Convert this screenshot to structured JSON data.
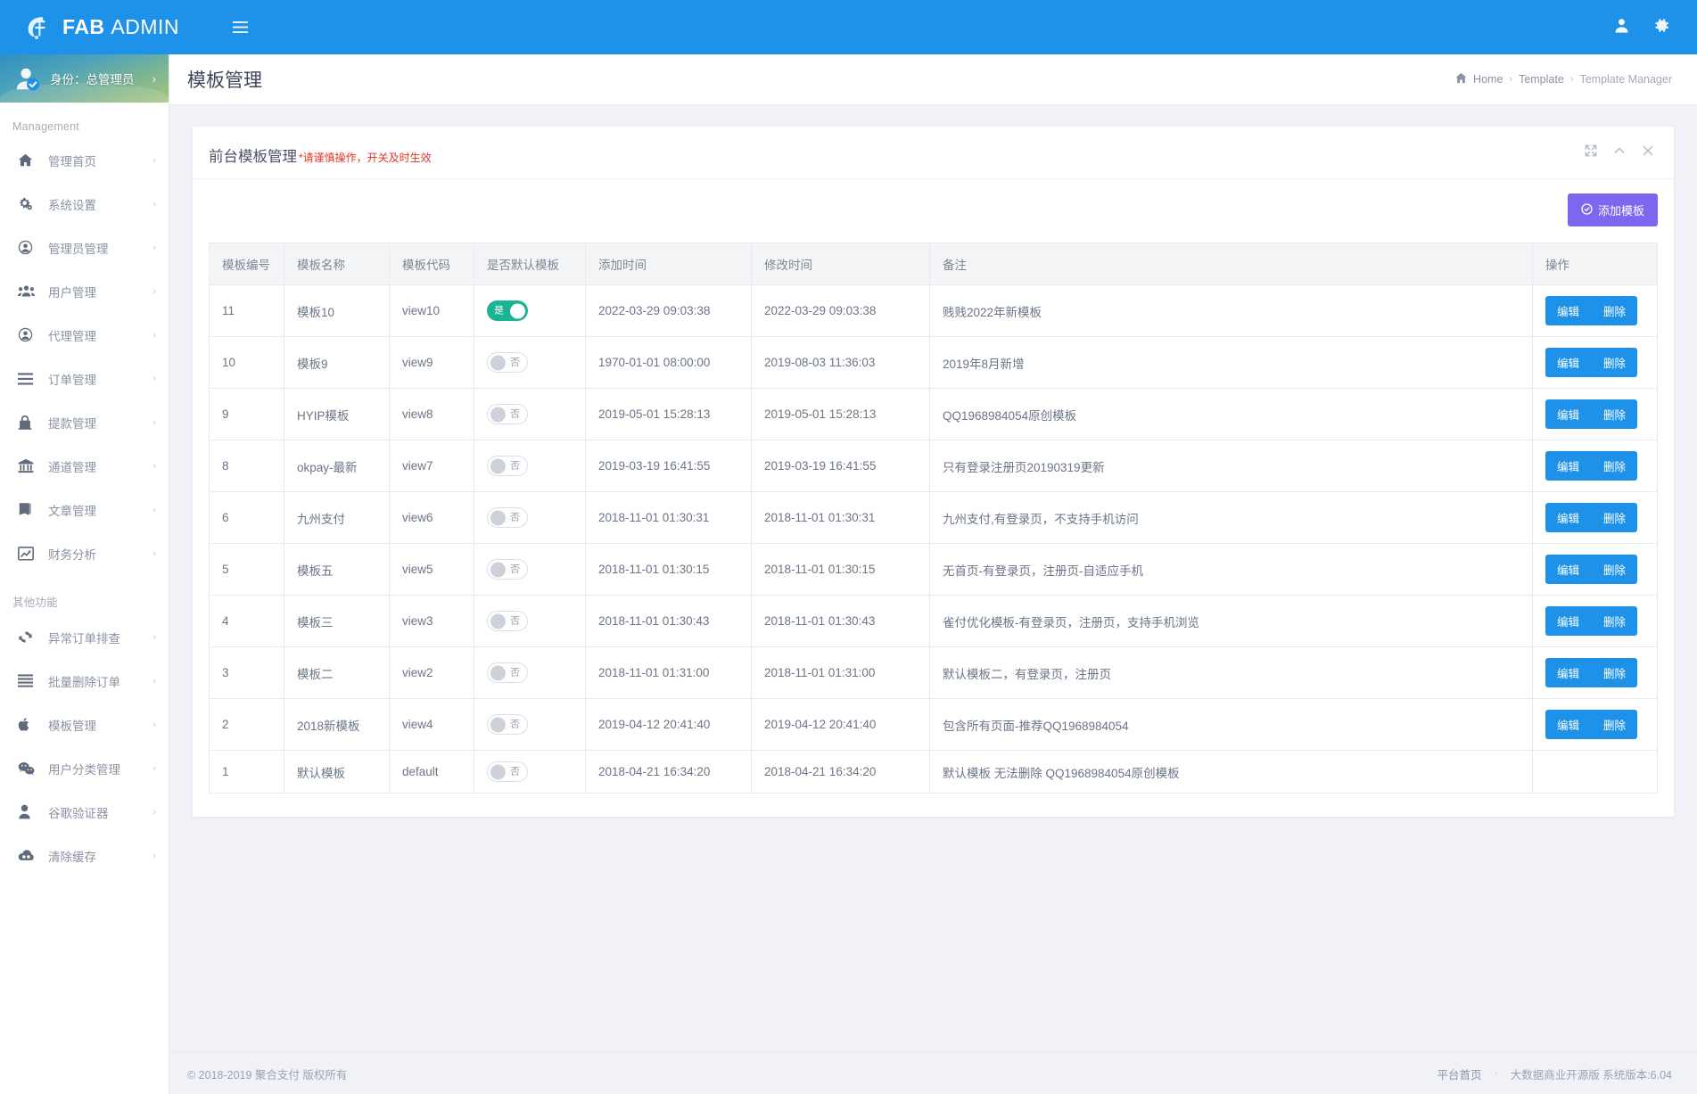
{
  "brand": {
    "bold": "FAB",
    "light": "ADMIN",
    "logo_icon": "fab-logo-icon"
  },
  "topbar": {
    "menu_toggle_icon": "hamburger-icon",
    "user_icon": "user-icon",
    "settings_icon": "gear-icon"
  },
  "sidebar": {
    "profile": {
      "label": "身份：总管理员",
      "avatar_icon": "avatar-verified-icon",
      "caret": "›"
    },
    "sections": [
      {
        "title": "Management",
        "items": [
          {
            "label": "管理首页",
            "icon": "home-icon"
          },
          {
            "label": "系统设置",
            "icon": "gears-icon"
          },
          {
            "label": "管理员管理",
            "icon": "user-circle-icon"
          },
          {
            "label": "用户管理",
            "icon": "users-icon"
          },
          {
            "label": "代理管理",
            "icon": "user-circle-icon"
          },
          {
            "label": "订单管理",
            "icon": "list-icon"
          },
          {
            "label": "提款管理",
            "icon": "lock-icon"
          },
          {
            "label": "通道管理",
            "icon": "bank-icon"
          },
          {
            "label": "文章管理",
            "icon": "book-icon"
          },
          {
            "label": "财务分析",
            "icon": "chart-line-icon"
          }
        ]
      },
      {
        "title": "其他功能",
        "items": [
          {
            "label": "异常订单排查",
            "icon": "refresh-icon"
          },
          {
            "label": "批量删除订单",
            "icon": "list-icon"
          },
          {
            "label": "模板管理",
            "icon": "apple-icon"
          },
          {
            "label": "用户分类管理",
            "icon": "wechat-icon"
          },
          {
            "label": "谷歌验证器",
            "icon": "person-icon"
          },
          {
            "label": "清除缓存",
            "icon": "cloud-icon"
          }
        ]
      }
    ]
  },
  "page": {
    "title": "模板管理",
    "breadcrumb": {
      "home_icon": "dashboard-icon",
      "home": "Home",
      "sep": "›",
      "middle": "Template",
      "current": "Template Manager"
    }
  },
  "card": {
    "title": "前台模板管理",
    "subtitle": "*请谨慎操作，开关及时生效",
    "tools": {
      "expand_icon": "expand-icon",
      "collapse_icon": "chevron-up-icon",
      "close_icon": "close-icon"
    },
    "add_button": {
      "label": "添加模板",
      "icon": "check-circle-icon"
    }
  },
  "table": {
    "headers": [
      "模板编号",
      "模板名称",
      "模板代码",
      "是否默认模板",
      "添加时间",
      "修改时间",
      "备注",
      "操作"
    ],
    "switch_labels": {
      "on": "是",
      "off": "否"
    },
    "actions": {
      "edit": "编辑",
      "delete": "删除"
    },
    "rows": [
      {
        "id": "11",
        "name": "模板10",
        "code": "view10",
        "is_default": true,
        "added": "2022-03-29 09:03:38",
        "modified": "2022-03-29 09:03:38",
        "remark": "贱贱2022年新模板",
        "has_actions": true
      },
      {
        "id": "10",
        "name": "模板9",
        "code": "view9",
        "is_default": false,
        "added": "1970-01-01 08:00:00",
        "modified": "2019-08-03 11:36:03",
        "remark": "2019年8月新增",
        "has_actions": true
      },
      {
        "id": "9",
        "name": "HYIP模板",
        "code": "view8",
        "is_default": false,
        "added": "2019-05-01 15:28:13",
        "modified": "2019-05-01 15:28:13",
        "remark": "QQ1968984054原创模板",
        "has_actions": true
      },
      {
        "id": "8",
        "name": "okpay-最新",
        "code": "view7",
        "is_default": false,
        "added": "2019-03-19 16:41:55",
        "modified": "2019-03-19 16:41:55",
        "remark": "只有登录注册页20190319更新",
        "has_actions": true
      },
      {
        "id": "6",
        "name": "九州支付",
        "code": "view6",
        "is_default": false,
        "added": "2018-11-01 01:30:31",
        "modified": "2018-11-01 01:30:31",
        "remark": "九州支付,有登录页，不支持手机访问",
        "has_actions": true
      },
      {
        "id": "5",
        "name": "模板五",
        "code": "view5",
        "is_default": false,
        "added": "2018-11-01 01:30:15",
        "modified": "2018-11-01 01:30:15",
        "remark": "无首页-有登录页，注册页-自适应手机",
        "has_actions": true
      },
      {
        "id": "4",
        "name": "模板三",
        "code": "view3",
        "is_default": false,
        "added": "2018-11-01 01:30:43",
        "modified": "2018-11-01 01:30:43",
        "remark": "雀付优化模板-有登录页，注册页，支持手机浏览",
        "has_actions": true
      },
      {
        "id": "3",
        "name": "模板二",
        "code": "view2",
        "is_default": false,
        "added": "2018-11-01 01:31:00",
        "modified": "2018-11-01 01:31:00",
        "remark": "默认模板二，有登录页，注册页",
        "has_actions": true
      },
      {
        "id": "2",
        "name": "2018新模板",
        "code": "view4",
        "is_default": false,
        "added": "2019-04-12 20:41:40",
        "modified": "2019-04-12 20:41:40",
        "remark": "包含所有页面-推荐QQ1968984054",
        "has_actions": true
      },
      {
        "id": "1",
        "name": "默认模板",
        "code": "default",
        "is_default": false,
        "added": "2018-04-21 16:34:20",
        "modified": "2018-04-21 16:34:20",
        "remark": "默认模板 无法删除 QQ1968984054原创模板",
        "has_actions": false
      }
    ]
  },
  "footer": {
    "copyright": "© 2018-2019 聚合支付 版权所有",
    "link": "平台首页",
    "dot": "·",
    "version": "大数据商业开源版 系统版本:6.04"
  },
  "colors": {
    "brand_blue": "#1e92e8",
    "accent_purple": "#7b68ee",
    "switch_on_green": "#1ab394",
    "warning_red": "#e2342b"
  }
}
